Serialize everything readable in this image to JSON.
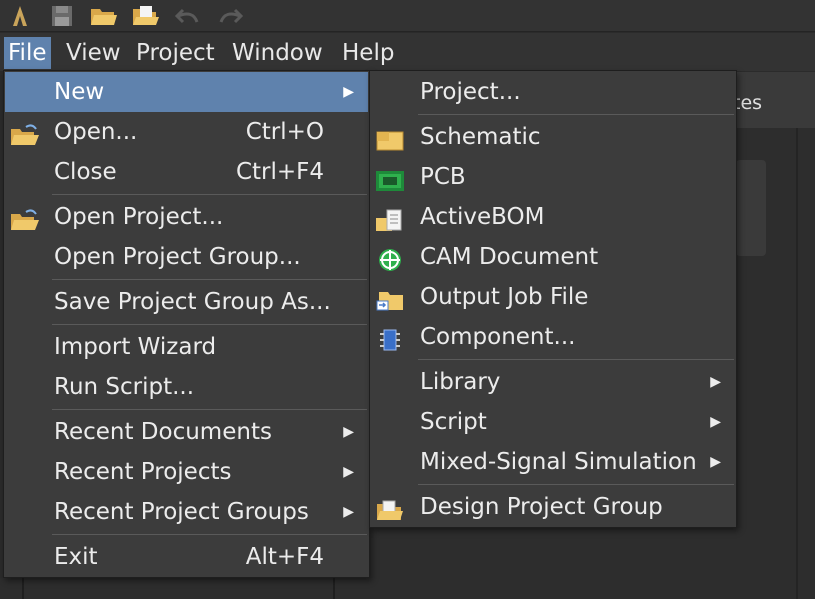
{
  "menubar": {
    "file": "File",
    "view": "View",
    "project": "Project",
    "window": "Window",
    "help": "Help"
  },
  "background": {
    "tab_fragment": "tes"
  },
  "file_menu": {
    "new": "New",
    "open": "Open...",
    "open_shortcut": "Ctrl+O",
    "close": "Close",
    "close_shortcut": "Ctrl+F4",
    "open_project": "Open Project...",
    "open_project_group": "Open Project Group...",
    "save_project_group_as": "Save Project Group As...",
    "import_wizard": "Import Wizard",
    "run_script": "Run Script...",
    "recent_documents": "Recent Documents",
    "recent_projects": "Recent Projects",
    "recent_project_groups": "Recent Project Groups",
    "exit": "Exit",
    "exit_shortcut": "Alt+F4"
  },
  "new_menu": {
    "project": "Project...",
    "schematic": "Schematic",
    "pcb": "PCB",
    "activebom": "ActiveBOM",
    "cam_document": "CAM Document",
    "output_job_file": "Output Job File",
    "component": "Component...",
    "library": "Library",
    "script": "Script",
    "mixed_signal_simulation": "Mixed-Signal Simulation",
    "design_project_group": "Design Project Group"
  },
  "colors": {
    "menu_bg": "#3c3c3c",
    "highlight": "#5f82ad",
    "text": "#ececec"
  }
}
